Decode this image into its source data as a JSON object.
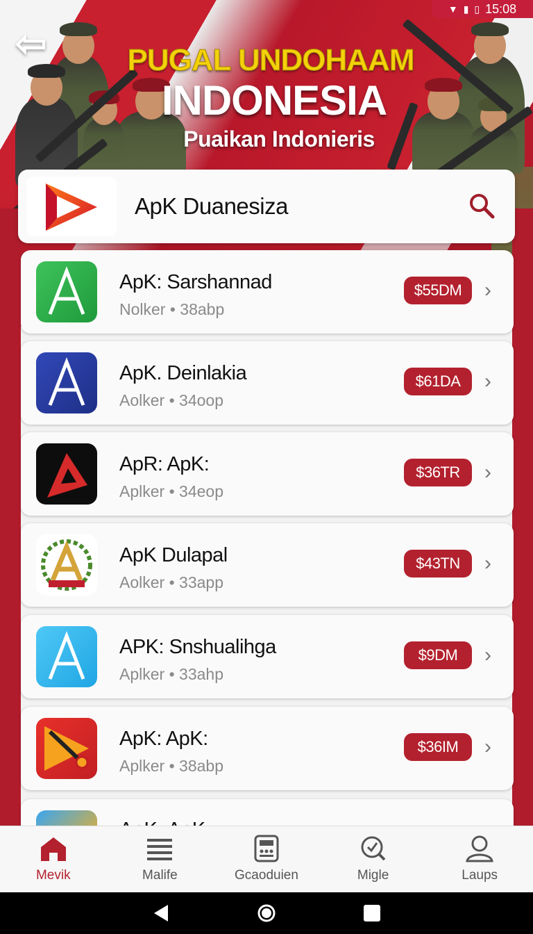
{
  "status": {
    "time": "15:08"
  },
  "banner": {
    "title_top": "PUGAL UNDOHAAM",
    "title_main": "INDONESIA",
    "title_sub": "Puaikan Indonieris"
  },
  "search": {
    "title": "ApK Duanesiza"
  },
  "apps": [
    {
      "name": "ApK: Sarshannad",
      "meta": "Nolker • 38abp",
      "price": "$55DM",
      "icon": "app-icon-green-a",
      "color": "#2faa4a"
    },
    {
      "name": "ApK. Deinlakia",
      "meta": "Aolker • 34oop",
      "price": "$61DA",
      "icon": "app-icon-blue-a",
      "color": "#2b3fa0"
    },
    {
      "name": "ApR: ApK:",
      "meta": "Aplker • 34eop",
      "price": "$36TR",
      "icon": "app-icon-black-red",
      "color": "#111111"
    },
    {
      "name": "ApK Dulapal",
      "meta": "Aolker • 33app",
      "price": "$43TN",
      "icon": "app-icon-gold-emblem",
      "color": "#d4a43a"
    },
    {
      "name": "APK: Snshualihga",
      "meta": "Aplker • 33ahp",
      "price": "$9DM",
      "icon": "app-icon-lightblue-a",
      "color": "#33b5ee"
    },
    {
      "name": "ApK: ApK:",
      "meta": "Aplker • 38abp",
      "price": "$36IM",
      "icon": "app-icon-red-orange",
      "color": "#d92a2a"
    }
  ],
  "partial_app": {
    "name": "ApK: ApK:"
  },
  "nav": [
    {
      "label": "Mevik",
      "icon": "home-icon",
      "active": true
    },
    {
      "label": "Malife",
      "icon": "menu-icon",
      "active": false
    },
    {
      "label": "Gcaoduien",
      "icon": "calculator-icon",
      "active": false
    },
    {
      "label": "Migle",
      "icon": "search-check-icon",
      "active": false
    },
    {
      "label": "Laups",
      "icon": "user-icon",
      "active": false
    }
  ],
  "colors": {
    "accent": "#b3212e",
    "banner_red": "#c8202f"
  }
}
